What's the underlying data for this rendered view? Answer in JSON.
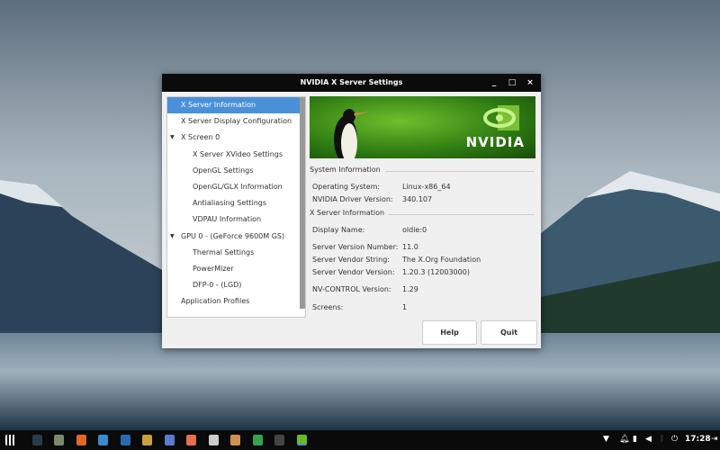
{
  "window": {
    "title": "NVIDIA X Server Settings",
    "minimize": "_",
    "maximize": "□",
    "close": "×"
  },
  "tree": [
    {
      "label": "X Server Information",
      "level": 0,
      "selected": true
    },
    {
      "label": "X Server Display Configuration",
      "level": 0
    },
    {
      "label": "X Screen 0",
      "level": 0,
      "expanded": true
    },
    {
      "label": "X Server XVideo Settings",
      "level": 1
    },
    {
      "label": "OpenGL Settings",
      "level": 1
    },
    {
      "label": "OpenGL/GLX Information",
      "level": 1
    },
    {
      "label": "Antialiasing Settings",
      "level": 1
    },
    {
      "label": "VDPAU Information",
      "level": 1
    },
    {
      "label": "GPU 0 - (GeForce 9600M GS)",
      "level": 0,
      "expanded": true
    },
    {
      "label": "Thermal Settings",
      "level": 1
    },
    {
      "label": "PowerMizer",
      "level": 1
    },
    {
      "label": "DFP-0 - (LGD)",
      "level": 1
    },
    {
      "label": "Application Profiles",
      "level": 0
    }
  ],
  "banner": {
    "logo_text": "NVIDIA",
    "brand_color": "#76b900"
  },
  "system": {
    "heading": "System Information",
    "rows": [
      {
        "label": "Operating System:",
        "value": "Linux-x86_64"
      },
      {
        "label": "NVIDIA Driver Version:",
        "value": "340.107"
      }
    ]
  },
  "xserver": {
    "heading": "X Server Information",
    "rows": [
      {
        "label": "Display Name:",
        "value": "oldie:0"
      },
      {
        "label": "Server Version Number:",
        "value": "11.0"
      },
      {
        "label": "Server Vendor String:",
        "value": "The X.Org Foundation"
      },
      {
        "label": "Server Vendor Version:",
        "value": "1.20.3 (12003000)"
      },
      {
        "label": "NV-CONTROL Version:",
        "value": "1.29"
      },
      {
        "label": "Screens:",
        "value": "1"
      }
    ]
  },
  "buttons": {
    "help": "Help",
    "quit": "Quit"
  },
  "taskbar": {
    "clock": "17:28",
    "apps": [
      "app-grid",
      "desktop",
      "files",
      "firefox",
      "thunderbird",
      "screenshot",
      "rhythmbox",
      "writer",
      "impress",
      "text-editor",
      "downloader",
      "image-viewer",
      "terminal",
      "nvidia-settings"
    ]
  }
}
